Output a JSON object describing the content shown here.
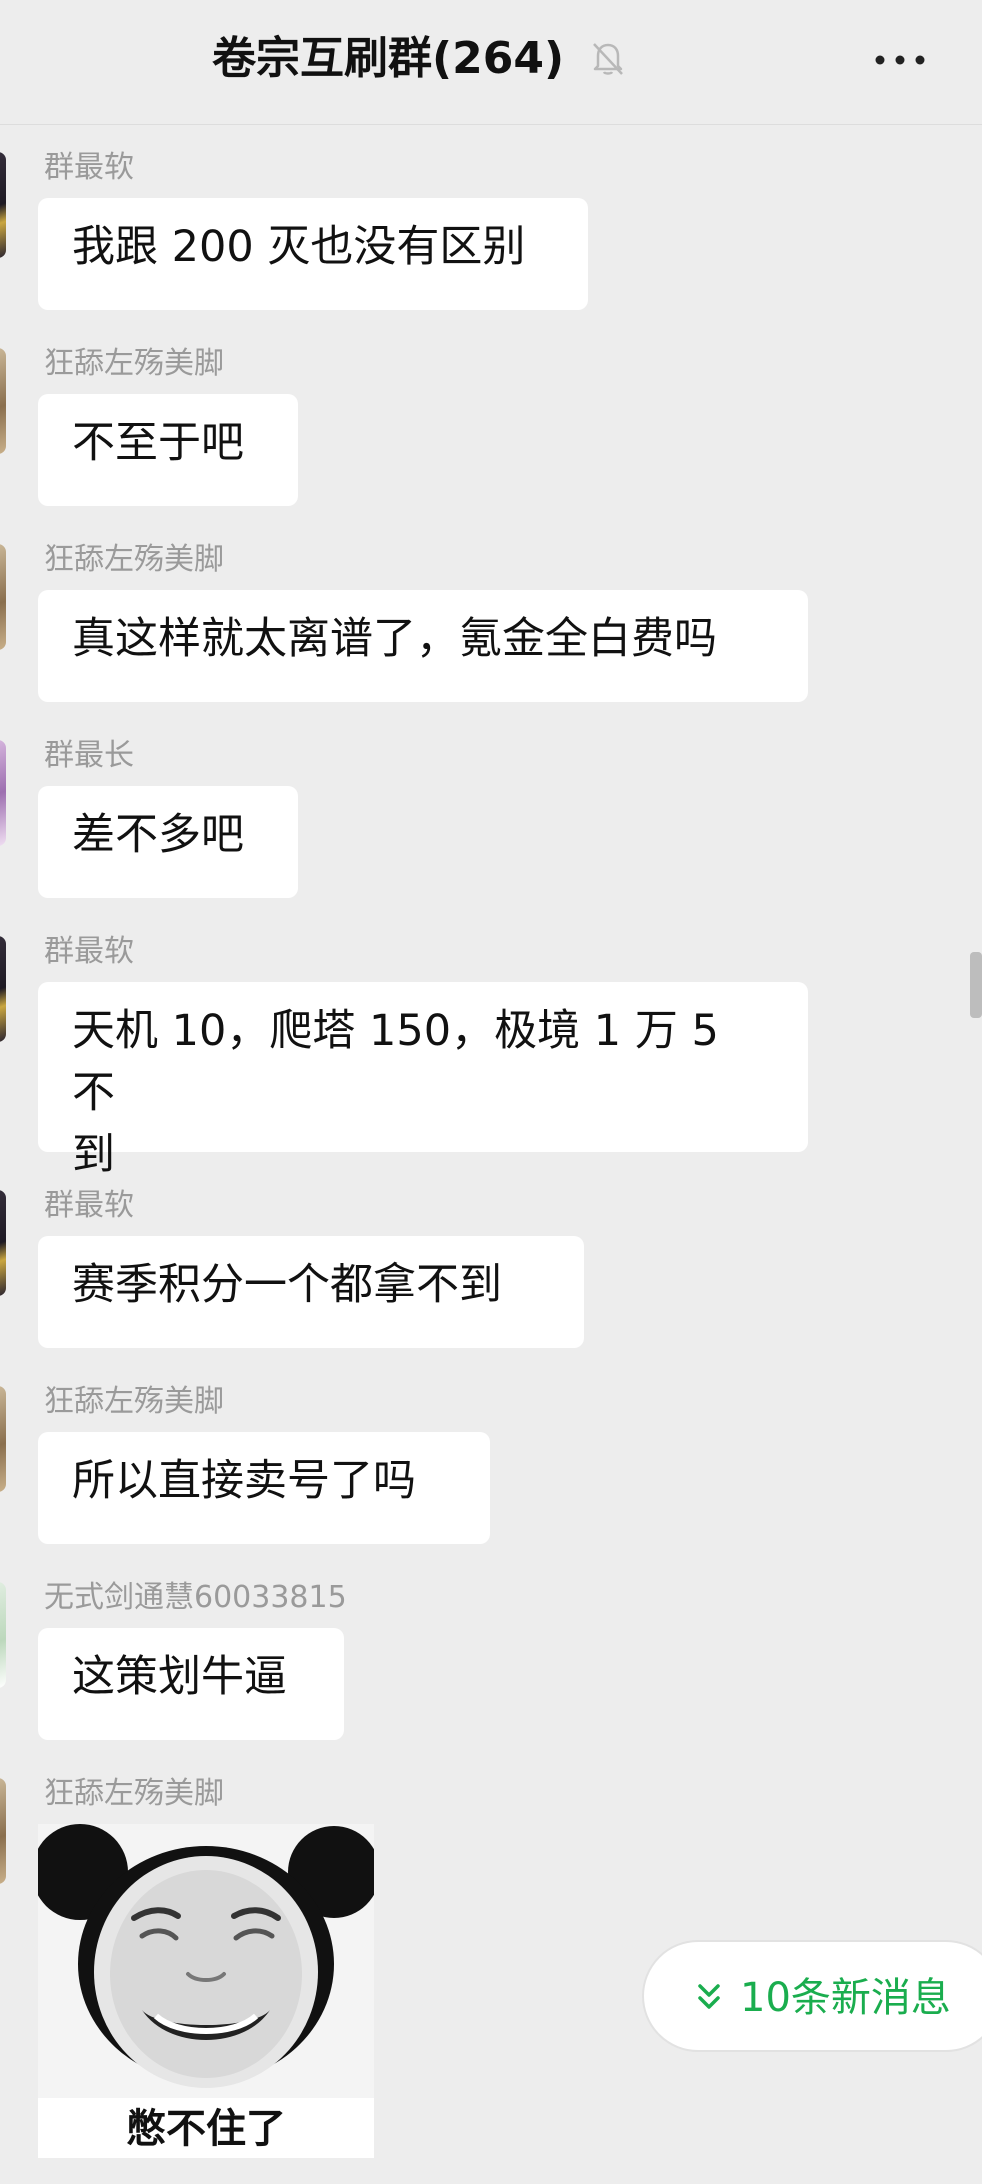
{
  "header": {
    "title": "卷宗互刷群(264)",
    "mute_icon": "bell-muted-icon",
    "more_icon": "more-dots-icon"
  },
  "messages": [
    {
      "sender": "群最软",
      "text": "我跟 200 灭也没有区别"
    },
    {
      "sender": "狂舔左殇美脚",
      "text": "不至于吧"
    },
    {
      "sender": "狂舔左殇美脚",
      "text": "真这样就太离谱了，氪金全白费吗"
    },
    {
      "sender": "群最长",
      "text": "差不多吧"
    },
    {
      "sender": "群最软",
      "text_line1": "天机 10，爬塔 150，极境 1 万 5 不",
      "text_line2": "到"
    },
    {
      "sender": "群最软",
      "text": "赛季积分一个都拿不到"
    },
    {
      "sender": "狂舔左殇美脚",
      "text": "所以直接卖号了吗"
    },
    {
      "sender": "无式剑通慧60033815",
      "text": "这策划牛逼"
    },
    {
      "sender": "狂舔左殇美脚",
      "sticker_caption": "憋不住了"
    }
  ],
  "new_messages": {
    "label": "10条新消息",
    "color": "#1aad4e"
  },
  "colors": {
    "background": "#ededed",
    "bubble": "#ffffff",
    "sender_text": "#9a9a9a"
  }
}
